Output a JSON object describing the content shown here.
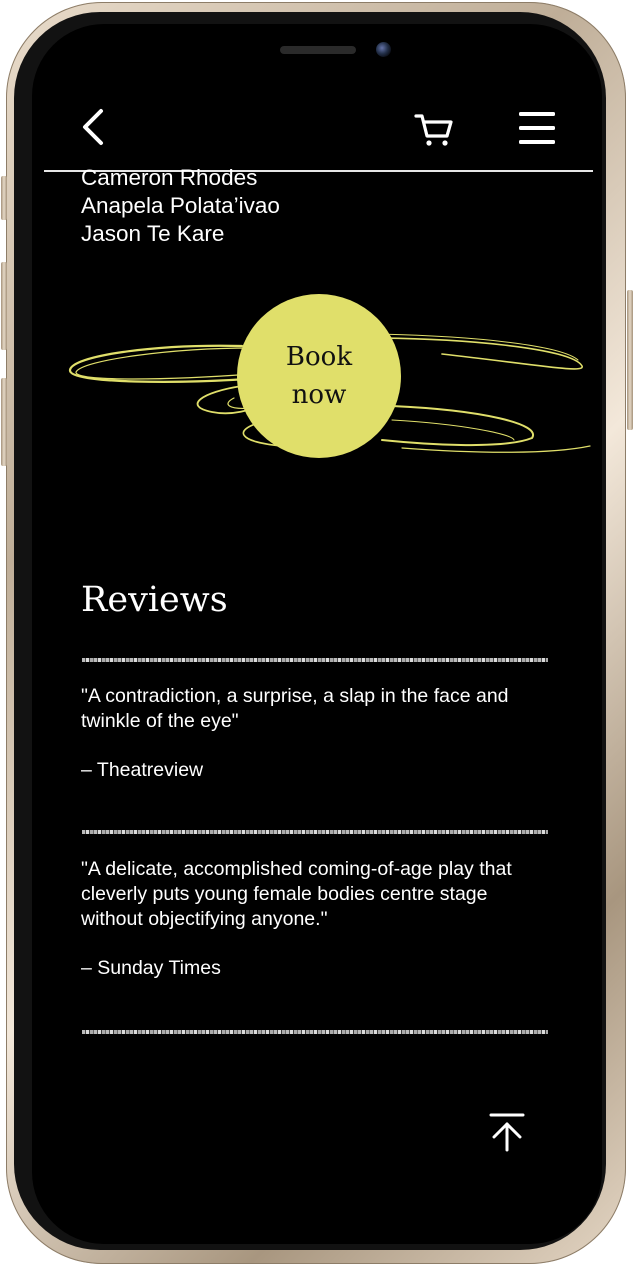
{
  "header": {
    "back_icon": "back-chevron-icon",
    "cart_icon": "shopping-cart-icon",
    "menu_icon": "hamburger-menu-icon"
  },
  "cast": [
    "Cameron Rhodes",
    "Anapela Polata’ivao",
    "Jason Te Kare"
  ],
  "book": {
    "label_line1": "Book",
    "label_line2": "now",
    "accent": "#e0df6a"
  },
  "reviews": {
    "title": "Reviews",
    "items": [
      {
        "quote": "\"A contradiction, a surprise, a slap in the face and twinkle of the eye\"",
        "source": "– Theatreview"
      },
      {
        "quote": "\"A delicate, accomplished coming-of-age play that cleverly puts young female bodies centre stage without objectifying anyone.\"",
        "source": "– Sunday Times"
      }
    ]
  },
  "footer": {
    "top_icon": "scroll-to-top-icon"
  },
  "colors": {
    "background": "#000000",
    "text": "#ffffff",
    "frame": "#cdbda6"
  }
}
